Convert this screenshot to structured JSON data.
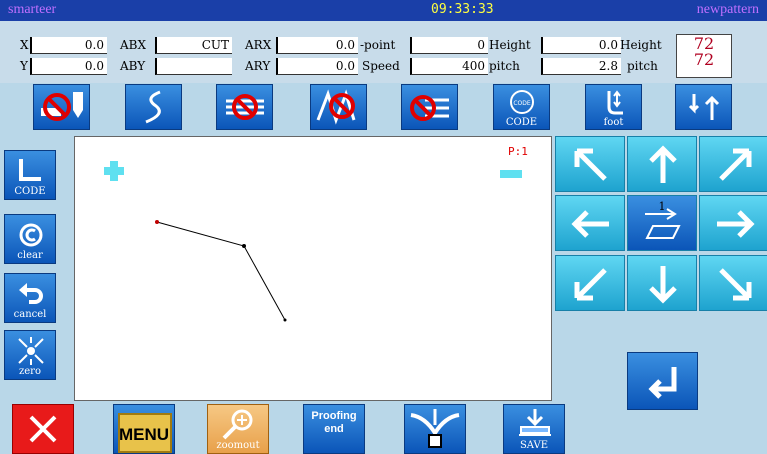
{
  "title": {
    "app": "smarteer",
    "time": "09:33:33",
    "file": "newpattern"
  },
  "info": {
    "x_label": "X",
    "x_value": "0.0",
    "y_label": "Y",
    "y_value": "0.0",
    "abx_label": "ABX",
    "abx_value": "CUT",
    "aby_label": "ABY",
    "aby_value": "",
    "arx_label": "ARX",
    "arx_value": "0.0",
    "ary_label": "ARY",
    "ary_value": "0.0",
    "point_label": "-point",
    "point_value": "0",
    "speed_label": "Speed",
    "speed_value": "400",
    "height1_label": "Height",
    "height1_value": "0.0",
    "pitch1_label": "pitch",
    "pitch1_value": "2.8",
    "height2_label": "Height",
    "height2_value": "72",
    "pitch2_label": "pitch",
    "pitch2_value": "72"
  },
  "toolbar": {
    "code_label": "CODE",
    "foot_label": "foot"
  },
  "side": {
    "code_label": "CODE",
    "clear_label": "clear",
    "cancel_label": "cancel",
    "zero_label": "zero"
  },
  "canvas": {
    "point_count": "P:1"
  },
  "arrows": {
    "center_label": "1"
  },
  "bottom": {
    "menu_label": "MENU",
    "zoomout_label": "zoomout",
    "proofing_label": "Proofing end",
    "save_label": "SAVE"
  },
  "colors": {
    "accent": "#1a3fa8",
    "button_blue": "#0b55b8",
    "arrow_cyan": "#1ea3cf",
    "stop_red": "#e00000"
  }
}
